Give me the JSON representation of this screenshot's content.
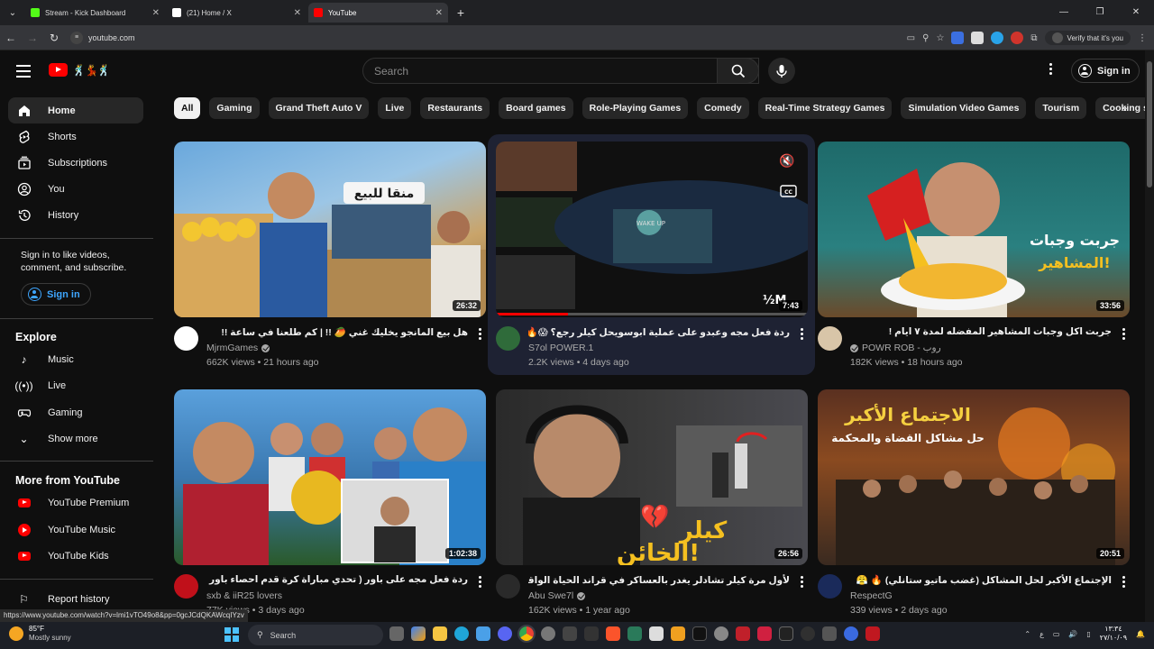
{
  "browser": {
    "tabs": [
      {
        "title": "Stream - Kick Dashboard",
        "favicon_color": "#53fc18"
      },
      {
        "title": "(21) Home / X",
        "favicon_color": "#ffffff"
      },
      {
        "title": "YouTube",
        "favicon_color": "#ff0000"
      }
    ],
    "address": "youtube.com",
    "profile_label": "Verify that it's you",
    "status_url": "https://www.youtube.com/watch?v=lmi1vTO49o8&pp=0gcJCdQKAWcqIYzv"
  },
  "masthead": {
    "search_placeholder": "Search",
    "signin_label": "Sign in"
  },
  "sidebar": {
    "main": [
      {
        "label": "Home",
        "icon": "home-icon"
      },
      {
        "label": "Shorts",
        "icon": "shorts-icon"
      },
      {
        "label": "Subscriptions",
        "icon": "subscriptions-icon"
      },
      {
        "label": "You",
        "icon": "you-icon"
      },
      {
        "label": "History",
        "icon": "history-icon"
      }
    ],
    "signin_message": "Sign in to like videos, comment, and subscribe.",
    "signin_label": "Sign in",
    "explore_heading": "Explore",
    "explore": [
      {
        "label": "Music",
        "icon": "music-icon"
      },
      {
        "label": "Live",
        "icon": "live-icon"
      },
      {
        "label": "Gaming",
        "icon": "gaming-icon"
      },
      {
        "label": "Show more",
        "icon": "chevron-down-icon"
      }
    ],
    "more_heading": "More from YouTube",
    "more": [
      {
        "label": "YouTube Premium"
      },
      {
        "label": "YouTube Music"
      },
      {
        "label": "YouTube Kids"
      }
    ],
    "report": "Report history"
  },
  "chips": [
    "All",
    "Gaming",
    "Grand Theft Auto V",
    "Live",
    "Restaurants",
    "Board games",
    "Role-Playing Games",
    "Comedy",
    "Real-Time Strategy Games",
    "Simulation Video Games",
    "Tourism",
    "Cooking shows"
  ],
  "videos": [
    {
      "title": "هل بيع المانجو يخليك غني 🥭 !! | كم طلعنا في ساعة !!",
      "channel": "MjrmGames",
      "verified": true,
      "stats": "662K views • 21 hours ago",
      "duration": "26:32",
      "avatar_color": "#ffffff",
      "thumb_colors": [
        "#4c8fc9",
        "#c9a46a"
      ]
    },
    {
      "title": "ردة فعل مجه وعبدو على عملية ابوسويحل كيلر رجع؟ 😱🔥 !",
      "channel": "S7ol POWER.1",
      "verified": false,
      "stats": "2.2K views • 4 days ago",
      "duration": "7:43",
      "avatar_color": "#2f6b3a",
      "thumb_colors": [
        "#151515",
        "#2a3a4a"
      ]
    },
    {
      "title": "جربت اكل وجبات المشاهير المفضله لمدة ٧ ايام !",
      "channel": "POWR ROB - روب",
      "verified": true,
      "stats": "182K views • 18 hours ago",
      "duration": "33:56",
      "avatar_color": "#d8c5a8",
      "thumb_colors": [
        "#2a6e6e",
        "#e8a030"
      ]
    },
    {
      "title": "ردة فعل مجه على باور ( تحدي مباراة كرة قدم احصاء باور ضد اليوتيوبرز )",
      "channel": "sxb & iiR25 lovers",
      "verified": false,
      "stats": "77K views • 3 days ago",
      "duration": "1:02:38",
      "avatar_color": "#c0101a",
      "thumb_colors": [
        "#4a90d0",
        "#b02030"
      ]
    },
    {
      "title": "لأول مرة كيلر تشادلر يغدر بالعساكر في قراند الحياة الواقعية 💔 !",
      "channel": "Abu Swe7l",
      "verified": true,
      "stats": "162K views • 1 year ago",
      "duration": "26:56",
      "avatar_color": "#2a2a2a",
      "thumb_colors": [
        "#3a3a3a",
        "#d04030"
      ]
    },
    {
      "title": "الإجتماع الأكبر لحل المشاكل (غضب ماتيو ستانلي) 🔥 😤",
      "channel": "RespectG",
      "verified": false,
      "stats": "339 views • 2 days ago",
      "duration": "20:51",
      "avatar_color": "#1a2a5a",
      "thumb_colors": [
        "#6a2a1a",
        "#d0a040"
      ]
    }
  ],
  "taskbar": {
    "temperature": "85°F",
    "condition": "Mostly sunny",
    "search_label": "Search",
    "time": "١٣:٣٤",
    "date": "٢٧/١٠/٠٩"
  }
}
